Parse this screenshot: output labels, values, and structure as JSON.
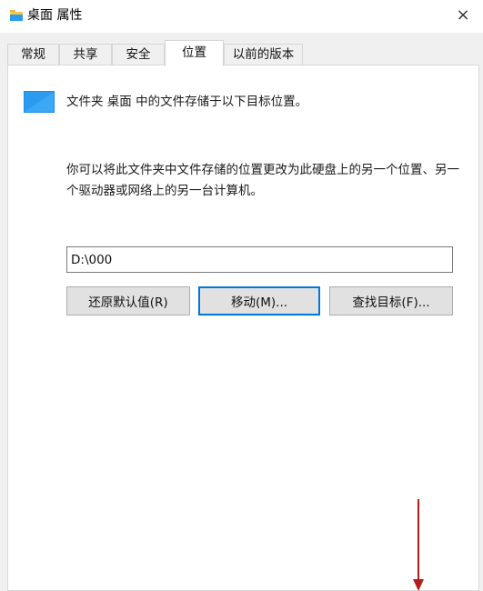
{
  "window": {
    "title": "桌面 属性",
    "close_symbol": "×"
  },
  "tabs": [
    {
      "label": "常规"
    },
    {
      "label": "共享"
    },
    {
      "label": "安全"
    },
    {
      "label": "位置"
    },
    {
      "label": "以前的版本"
    }
  ],
  "active_tab": "位置",
  "location": {
    "heading": "文件夹 桌面 中的文件存储于以下目标位置。",
    "description": "你可以将此文件夹中文件存储的位置更改为此硬盘上的另一个位置、另一个驱动器或网络上的另一台计算机。",
    "path_value": "D:\\000",
    "buttons": {
      "restore": "还原默认值(R)",
      "move": "移动(M)...",
      "find_target": "查找目标(F)..."
    }
  },
  "icons": {
    "title": "folder-icon",
    "folder": "folder-icon",
    "close": "close-icon",
    "annotation": "red-arrow-down"
  },
  "colors": {
    "folder_blue": "#2b9bf0",
    "focus_border": "#0078d7",
    "annotation_red": "#b51c1c"
  }
}
